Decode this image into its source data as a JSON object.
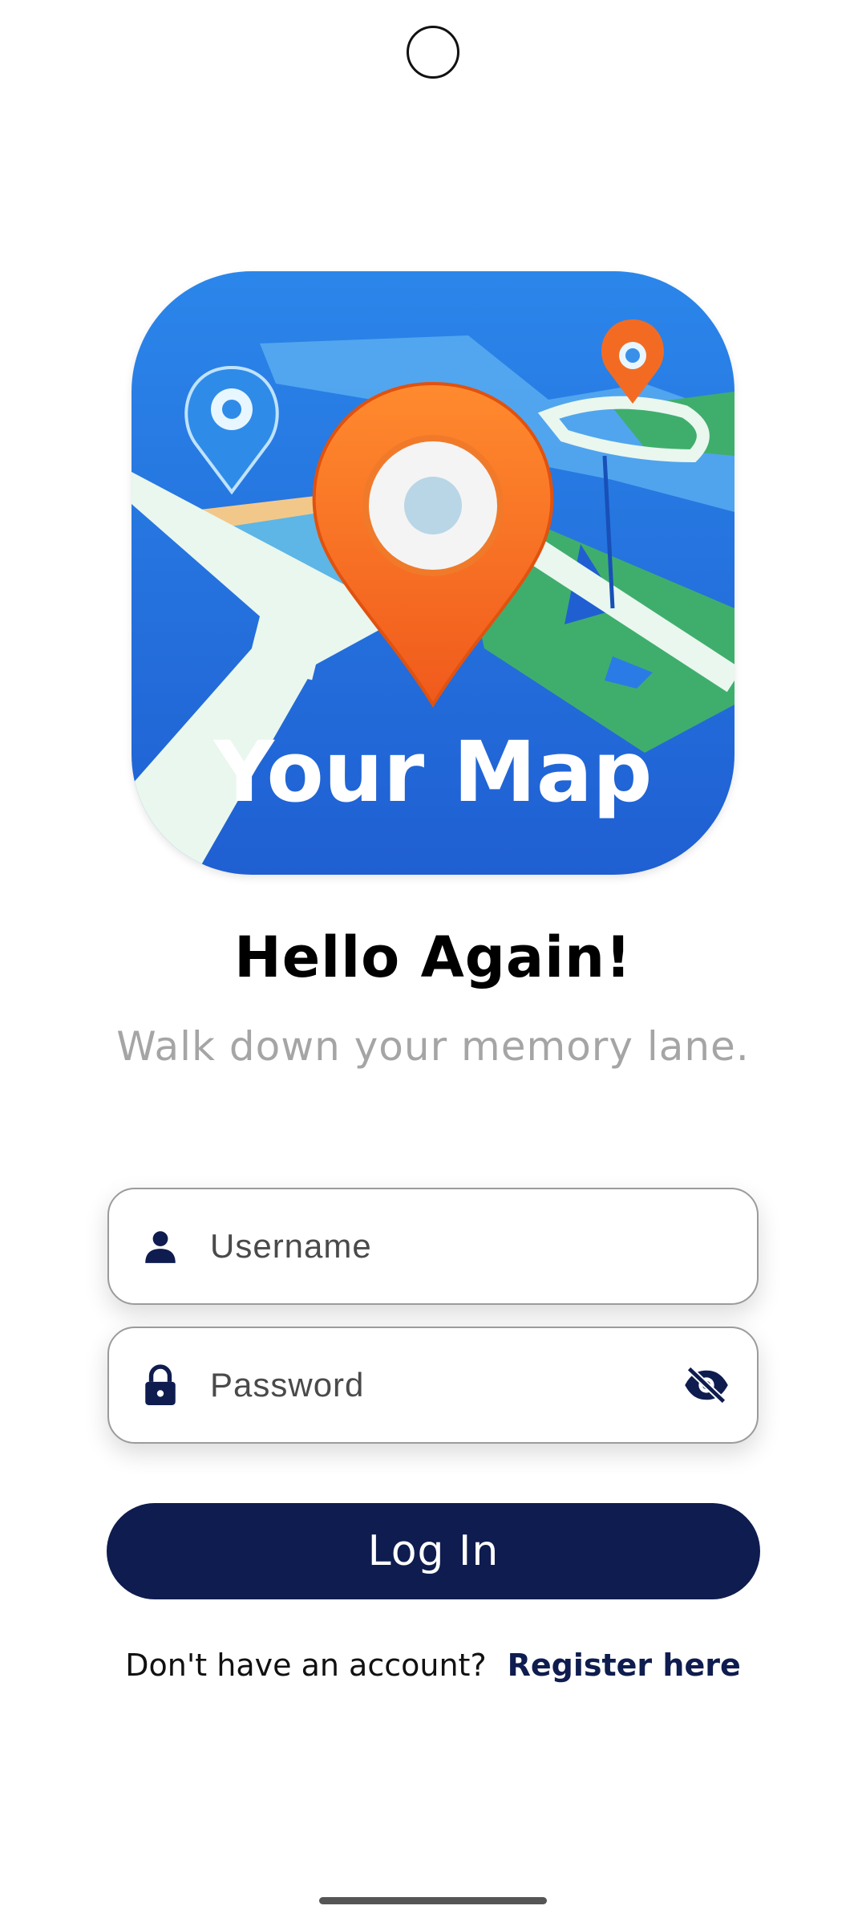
{
  "logo": {
    "text": "Your Map"
  },
  "heading": "Hello Again!",
  "subheading": "Walk down your memory lane.",
  "form": {
    "username": {
      "placeholder": "Username",
      "value": "",
      "icon": "person-icon"
    },
    "password": {
      "placeholder": "Password",
      "value": "",
      "icon": "lock-icon",
      "toggle_icon": "eye-off-icon"
    }
  },
  "login_button": "Log In",
  "register": {
    "prompt": "Don't have an account?",
    "link": "Register here"
  },
  "colors": {
    "primary": "#0f1c4f",
    "subtitle": "#a5a5a5",
    "logo_blue": "#2a7be6",
    "pin_orange": "#f26b21"
  }
}
